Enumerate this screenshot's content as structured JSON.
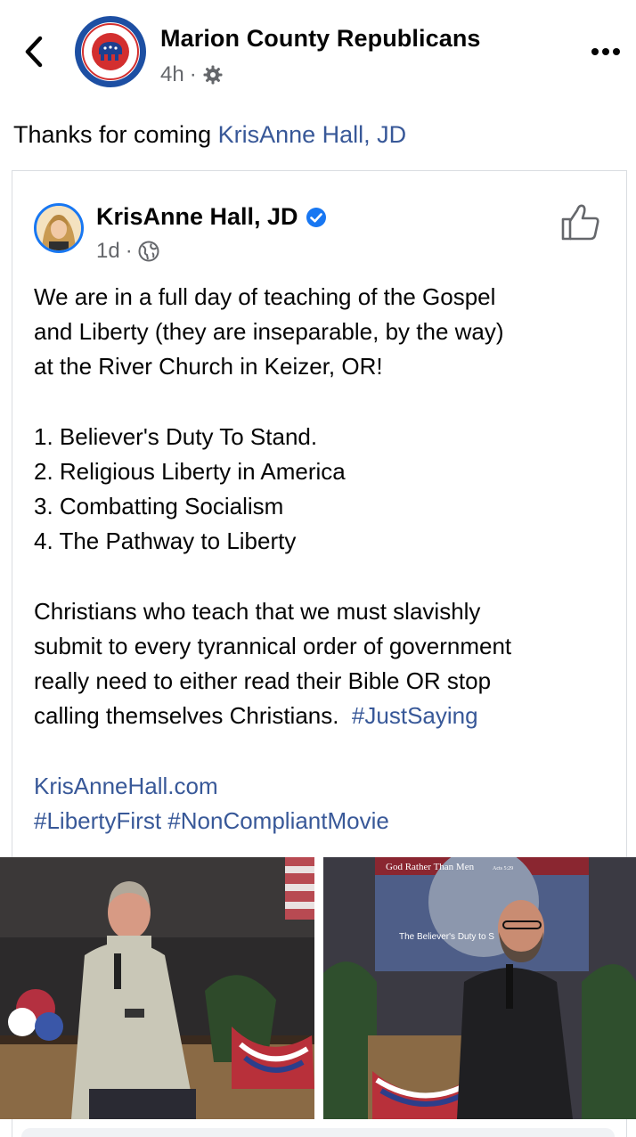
{
  "header": {
    "page_name": "Marion County Republicans",
    "time": "4h",
    "separator": "·",
    "avatar_text_top": "MARION",
    "avatar_text_right": "COUNTY",
    "avatar_text_bottom": "REPUBLICANS"
  },
  "caption": {
    "text": "Thanks for coming ",
    "mention": "KrisAnne Hall, JD"
  },
  "shared_post": {
    "author": "KrisAnne Hall, JD",
    "time": "1d",
    "separator": "·",
    "intro_line1": "We are in a full day of teaching of the Gospel",
    "intro_line2": "and Liberty (they are inseparable, by the way)",
    "intro_line3": "at the River Church in Keizer, OR!",
    "list": [
      "1. Believer's Duty To Stand.",
      "2. Religious Liberty in America",
      "3. Combatting Socialism",
      "4. The Pathway to Liberty"
    ],
    "para_line1": "Christians who teach that we must slavishly",
    "para_line2": "submit to every tyrannical order of government",
    "para_line3": "really need to either read their Bible OR stop",
    "para_line4": "calling themselves Christians.",
    "hashtag_inline": "#JustSaying",
    "website": "KrisAnneHall.com",
    "hashtag_1": "#LibertyFirst",
    "hashtag_2": "#NonCompliantMovie"
  },
  "photos": {
    "slide_title": "God Rather Than Men",
    "slide_ref": "Acts 5:29",
    "slide_subtitle": "The Believer's Duty to S"
  },
  "colors": {
    "link": "#385898",
    "verified": "#1877f2",
    "meta_text": "#65676b",
    "border": "#dadde1"
  },
  "icons": {
    "back": "chevron-left-icon",
    "more": "more-horizontal-icon",
    "privacy_custom": "gear-icon",
    "privacy_public": "globe-icon",
    "verified": "verified-badge-icon",
    "like": "thumbs-up-icon"
  }
}
